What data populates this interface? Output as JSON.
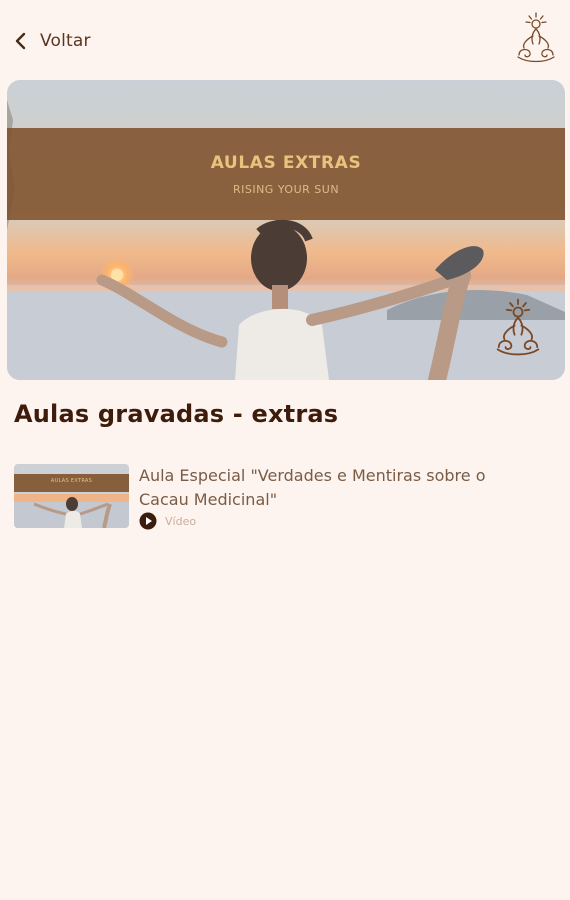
{
  "header": {
    "back_label": "Voltar"
  },
  "banner": {
    "title": "AULAS EXTRAS",
    "subtitle": "RISING YOUR SUN"
  },
  "section": {
    "title": "Aulas gravadas - extras"
  },
  "lessons": [
    {
      "title": "Aula Especial \"Verdades e Mentiras sobre o Cacau Medicinal\"",
      "type": "Vídeo",
      "thumb_caption": "AULAS EXTRAS"
    }
  ],
  "colors": {
    "background": "#fdf4ef",
    "brand_brown": "#3d1c0b",
    "band": "#80522c",
    "gold": "#e9c27d"
  },
  "icons": {
    "back": "chevron-left-icon",
    "logo": "meditation-logo-icon",
    "play": "play-circle-icon"
  }
}
